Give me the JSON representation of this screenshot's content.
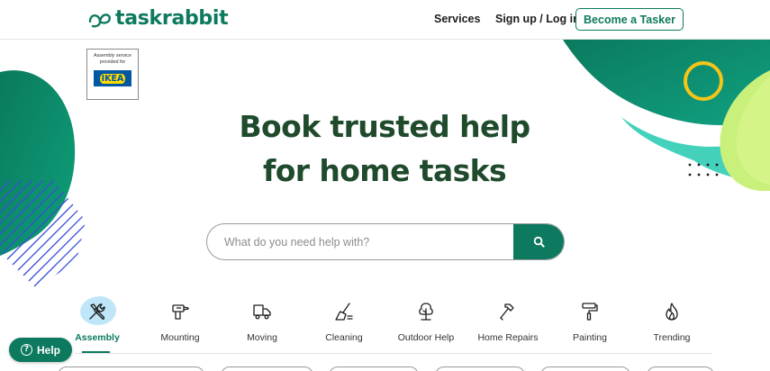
{
  "header": {
    "logo_text": "taskrabbit",
    "nav_services": "Services",
    "nav_signup": "Sign up / Log in",
    "become_tasker": "Become a Tasker"
  },
  "ikea_badge": {
    "caption": "Assembly service provided for",
    "logo_text": "IKEA"
  },
  "hero": {
    "title_line1": "Book trusted help",
    "title_line2": "for home tasks"
  },
  "search": {
    "placeholder": "What do you need help with?",
    "button_icon": "search-icon"
  },
  "categories": [
    {
      "label": "Assembly",
      "icon": "tools-icon",
      "active": true
    },
    {
      "label": "Mounting",
      "icon": "drill-icon",
      "active": false
    },
    {
      "label": "Moving",
      "icon": "truck-icon",
      "active": false
    },
    {
      "label": "Cleaning",
      "icon": "broom-icon",
      "active": false
    },
    {
      "label": "Outdoor Help",
      "icon": "tree-icon",
      "active": false
    },
    {
      "label": "Home Repairs",
      "icon": "hammer-icon",
      "active": false
    },
    {
      "label": "Painting",
      "icon": "paint-roller-icon",
      "active": false
    },
    {
      "label": "Trending",
      "icon": "flame-icon",
      "active": false
    }
  ],
  "help": {
    "label": "Help"
  },
  "colors": {
    "brand_green": "#0d7a5f",
    "hero_text": "#1f4a2c",
    "assembly_blob": "#bfe6f8"
  }
}
